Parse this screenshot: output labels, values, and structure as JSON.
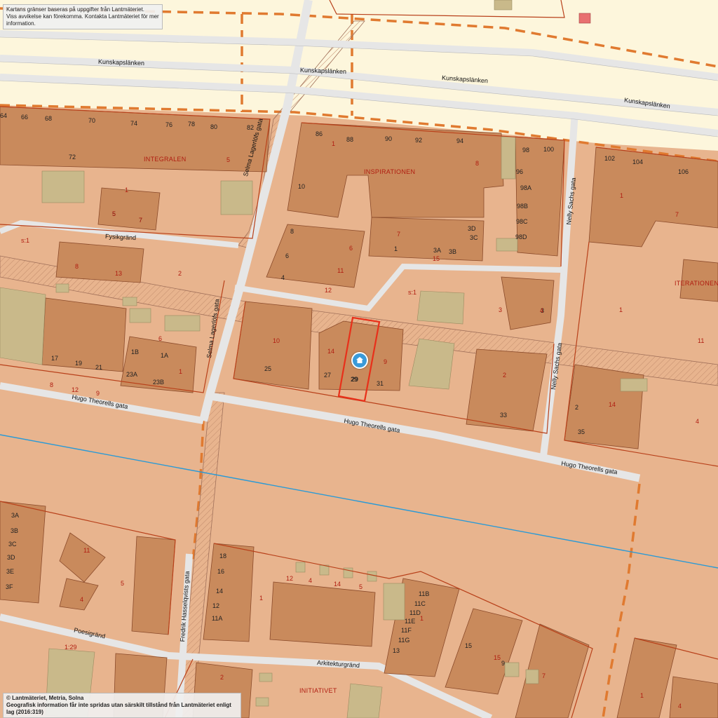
{
  "notices": {
    "top_line1": "Kartans gränser baseras på uppgifter från Lantmäteriet.",
    "top_line2": "Viss avvikelse kan förekomma. Kontakta Lantmäteriet för mer information.",
    "bottom_line1": "© Lantmäteriet, Metria, Solna",
    "bottom_line2": "Geografisk information får inte spridas utan särskilt tillstånd från Lantmäteriet enligt lag (2016:319)"
  },
  "streets": {
    "kunskapslanken": "Kunskapslänken",
    "fysikgrand": "Fysikgränd",
    "hugo_theorells": "Hugo Theorells gata",
    "selma_lagerlofs": "Selma Lagerlöfs gata",
    "nelly_sachs": "Nelly Sachs gata",
    "fredrik_hasselqvists": "Fredrik Hasselqvists gata",
    "poesigrand": "Poesigränd",
    "arkitekturgrand": "Arkitekturgränd"
  },
  "blocks": {
    "integralen": "INTEGRALEN",
    "inspirationen": "INSPIRATIONEN",
    "iterationen": "ITERATIONEN",
    "initiativet": "INITIATIVET"
  },
  "labels": {
    "s1": "s:1",
    "scale": "1:29"
  },
  "address_numbers": [
    "64",
    "66",
    "68",
    "70",
    "74",
    "76",
    "78",
    "80",
    "82",
    "72",
    "86",
    "88",
    "90",
    "92",
    "94",
    "98",
    "100",
    "96",
    "98A",
    "98B",
    "98C",
    "98D",
    "102",
    "104",
    "106",
    "10",
    "8",
    "6",
    "4",
    "3D",
    "3C",
    "3A",
    "3B",
    "1",
    "5",
    "7",
    "17",
    "19",
    "21",
    "1A",
    "1B",
    "23A",
    "23B",
    "25",
    "27",
    "29",
    "31",
    "33",
    "2",
    "35",
    "3",
    "3A",
    "3B",
    "3C",
    "3D",
    "3E",
    "3F",
    "18",
    "16",
    "14",
    "12",
    "11A",
    "11B",
    "11C",
    "11D",
    "11E",
    "11F",
    "11G",
    "13",
    "15",
    "9"
  ],
  "parcel_numbers": [
    "1",
    "5",
    "7",
    "8",
    "13",
    "6",
    "11",
    "12",
    "2",
    "3",
    "4",
    "14",
    "9",
    "10",
    "15"
  ],
  "selected_property": {
    "label": "29",
    "icon": "home-marker-icon"
  },
  "colors": {
    "background": "#e8b48e",
    "road": "#e6e6e6",
    "building": "#c98a5c",
    "building_edge": "#8a4a2a",
    "boundary": "#b8401a",
    "planned_line": "#e07a30",
    "water_line": "#2a9ad6",
    "yard_green": "#c9b98a",
    "highlight": "#e8301a"
  }
}
